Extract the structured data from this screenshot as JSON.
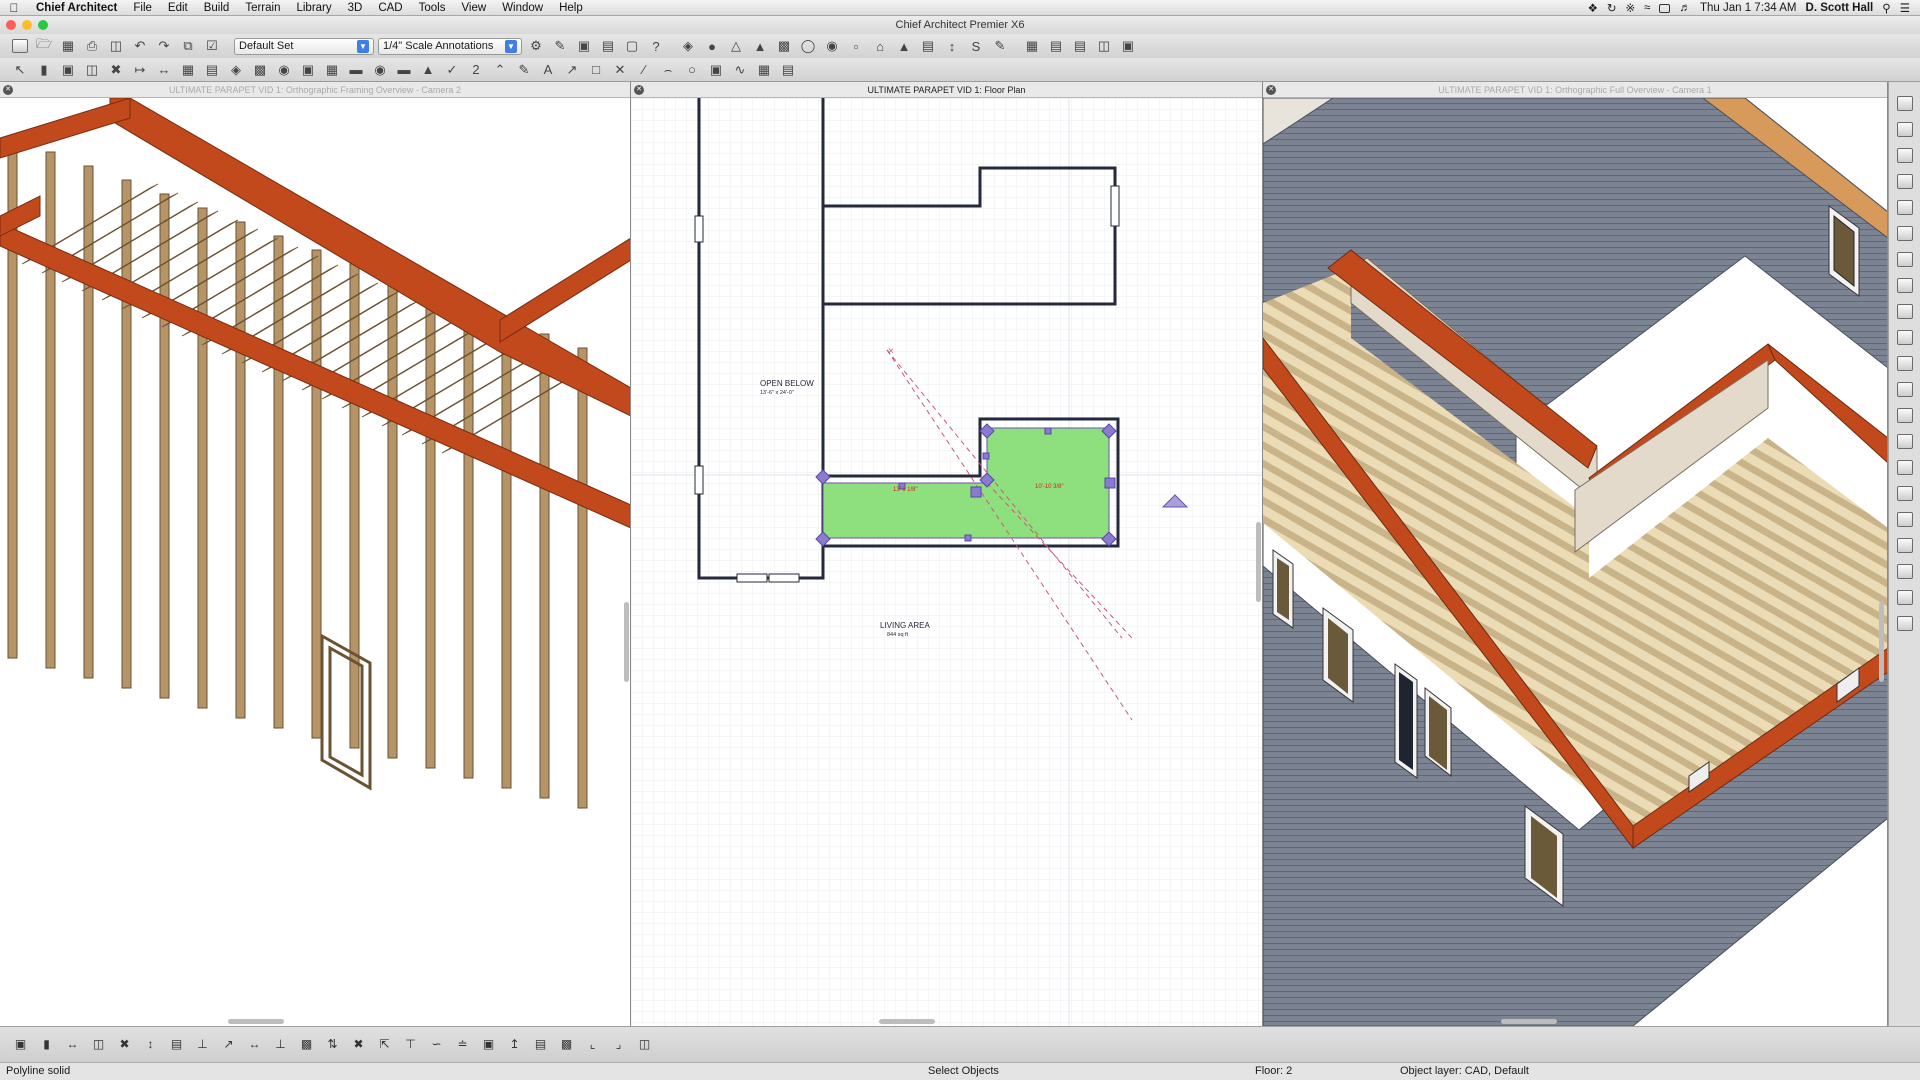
{
  "menubar": {
    "app_name": "Chief Architect",
    "items": [
      "File",
      "Edit",
      "Build",
      "Terrain",
      "Library",
      "3D",
      "CAD",
      "Tools",
      "View",
      "Window",
      "Help"
    ],
    "clock": "Thu Jan 1  7:34 AM",
    "user": "D. Scott Hall"
  },
  "window": {
    "title": "Chief Architect Premier X6"
  },
  "toolbar": {
    "layer_set": "Default Set",
    "annotation_set": "1/4\" Scale Annotations",
    "dimension_value": "2"
  },
  "panes": {
    "left_title": "ULTIMATE PARAPET VID 1: Orthographic Framing Overview - Camera 2",
    "center_title": "ULTIMATE PARAPET VID 1: Floor Plan",
    "right_title": "ULTIMATE PARAPET VID 1: Orthographic Full Overview - Camera 1"
  },
  "floor_plan": {
    "room1_name": "OPEN BELOW",
    "room1_size": "13'-6\" x 24'-0\"",
    "room2_name": "LIVING AREA",
    "room2_area": "844 sq ft",
    "dim1": "13' x 1/8\"",
    "dim2": "10'-10 3/8\""
  },
  "statusbar": {
    "left": "Polyline solid",
    "mode": "Select Objects",
    "floor": "Floor: 2",
    "layer": "Object layer: CAD,  Default"
  },
  "colors": {
    "lumber": "#b59468",
    "rim": "#c2491c",
    "siding": "#7c8494",
    "roof_fill": "#8ee07e",
    "selection": "#7c62b8"
  }
}
